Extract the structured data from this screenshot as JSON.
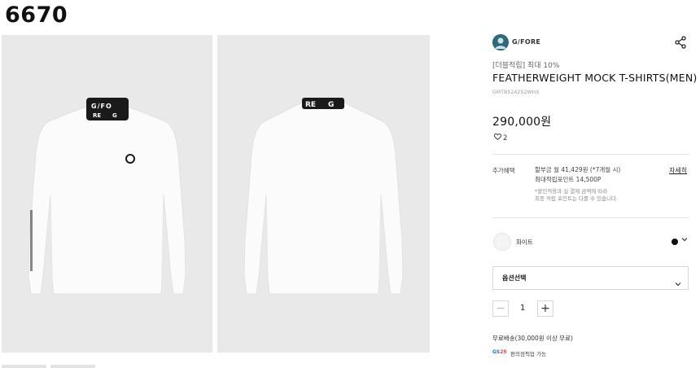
{
  "corner_label": "6670",
  "brand": {
    "name": "G/FORE",
    "logo_icon": "brand-avatar-icon"
  },
  "share_icon": "share-icon",
  "product": {
    "promo": "[더블적립] 최대 10%",
    "title": "FEATHERWEIGHT MOCK T-SHIRTS(MEN)",
    "code": "GMTB524252WHX",
    "price": "290,000원",
    "likes": "2"
  },
  "benefits": {
    "label": "추가혜택",
    "line1": "할부금 월 41,429원 (*7개월 시)",
    "line2": "최대적립포인트 14,500P",
    "note1": "*할인적용과 실 결제 금액에 따라",
    "note2": "최종 적립 포인트는 다를 수 있습니다.",
    "detail_link": "자세히"
  },
  "color_option": {
    "name": "화이트",
    "selected_color": "#111111"
  },
  "option_select": {
    "label": "옵션선택"
  },
  "quantity": {
    "minus": "−",
    "value": "1",
    "plus": "+"
  },
  "shipping": {
    "free_text": "무료배송(30,000원 이상 무료)",
    "gs_logo": "GS25",
    "gs_text": "편의점픽업 가능"
  },
  "colors": {
    "photo_bg": "#e9e9ea",
    "garment": "#fbfbfb",
    "neck_band": "#1a1a1a",
    "brand_logo_bg": "#2e6b7a"
  }
}
